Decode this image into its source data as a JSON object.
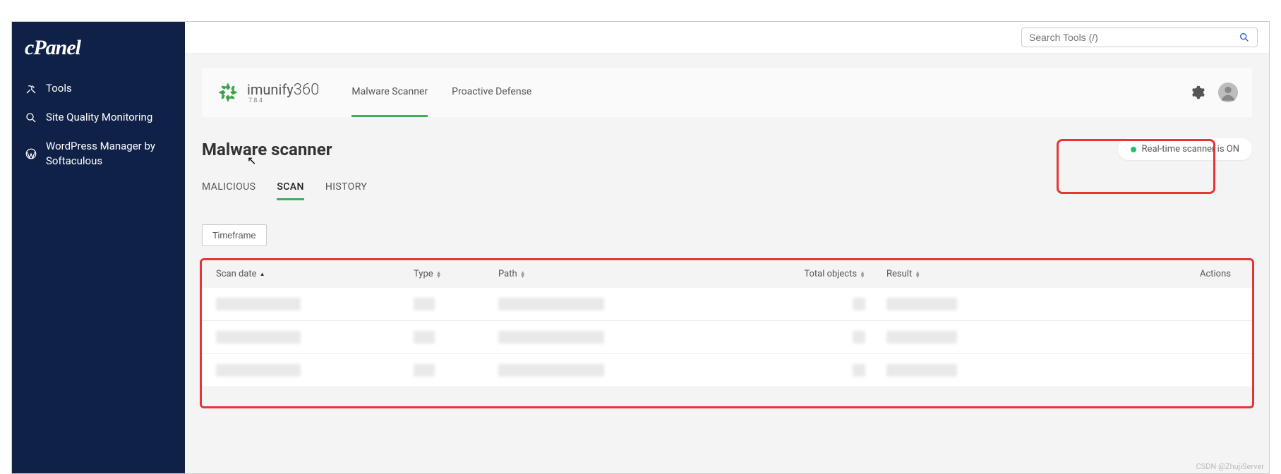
{
  "brand": {
    "logo_text": "cPanel"
  },
  "sidebar": {
    "items": [
      {
        "label": "Tools",
        "icon": "tools"
      },
      {
        "label": "Site Quality Monitoring",
        "icon": "magnifier"
      },
      {
        "label": "WordPress Manager by Softaculous",
        "icon": "wordpress"
      }
    ]
  },
  "topbar": {
    "search_placeholder": "Search Tools (/)"
  },
  "panel": {
    "product_name": "imunify",
    "product_suffix": "360",
    "version": "7.8.4",
    "tabs": [
      {
        "label": "Malware Scanner",
        "active": true
      },
      {
        "label": "Proactive Defense",
        "active": false
      }
    ]
  },
  "page": {
    "title": "Malware scanner",
    "status_text": "Real-time scanner is ON",
    "status_color": "#1ec36a"
  },
  "sub_tabs": [
    {
      "label": "MALICIOUS",
      "active": false
    },
    {
      "label": "SCAN",
      "active": true
    },
    {
      "label": "HISTORY",
      "active": false
    }
  ],
  "filters": {
    "timeframe_label": "Timeframe"
  },
  "table": {
    "columns": [
      {
        "key": "scan_date",
        "label": "Scan date",
        "sort": "asc"
      },
      {
        "key": "type",
        "label": "Type",
        "sort": "both"
      },
      {
        "key": "path",
        "label": "Path",
        "sort": "both"
      },
      {
        "key": "total_objects",
        "label": "Total objects",
        "sort": "both"
      },
      {
        "key": "result",
        "label": "Result",
        "sort": "both"
      },
      {
        "key": "actions",
        "label": "Actions",
        "sort": null
      }
    ],
    "rows": [
      {
        "scan_date": "",
        "type": "",
        "path": "",
        "total_objects": "",
        "result": ""
      },
      {
        "scan_date": "",
        "type": "",
        "path": "",
        "total_objects": "",
        "result": ""
      },
      {
        "scan_date": "",
        "type": "",
        "path": "",
        "total_objects": "",
        "result": ""
      }
    ]
  },
  "watermark": "CSDN @ZhujiServer"
}
